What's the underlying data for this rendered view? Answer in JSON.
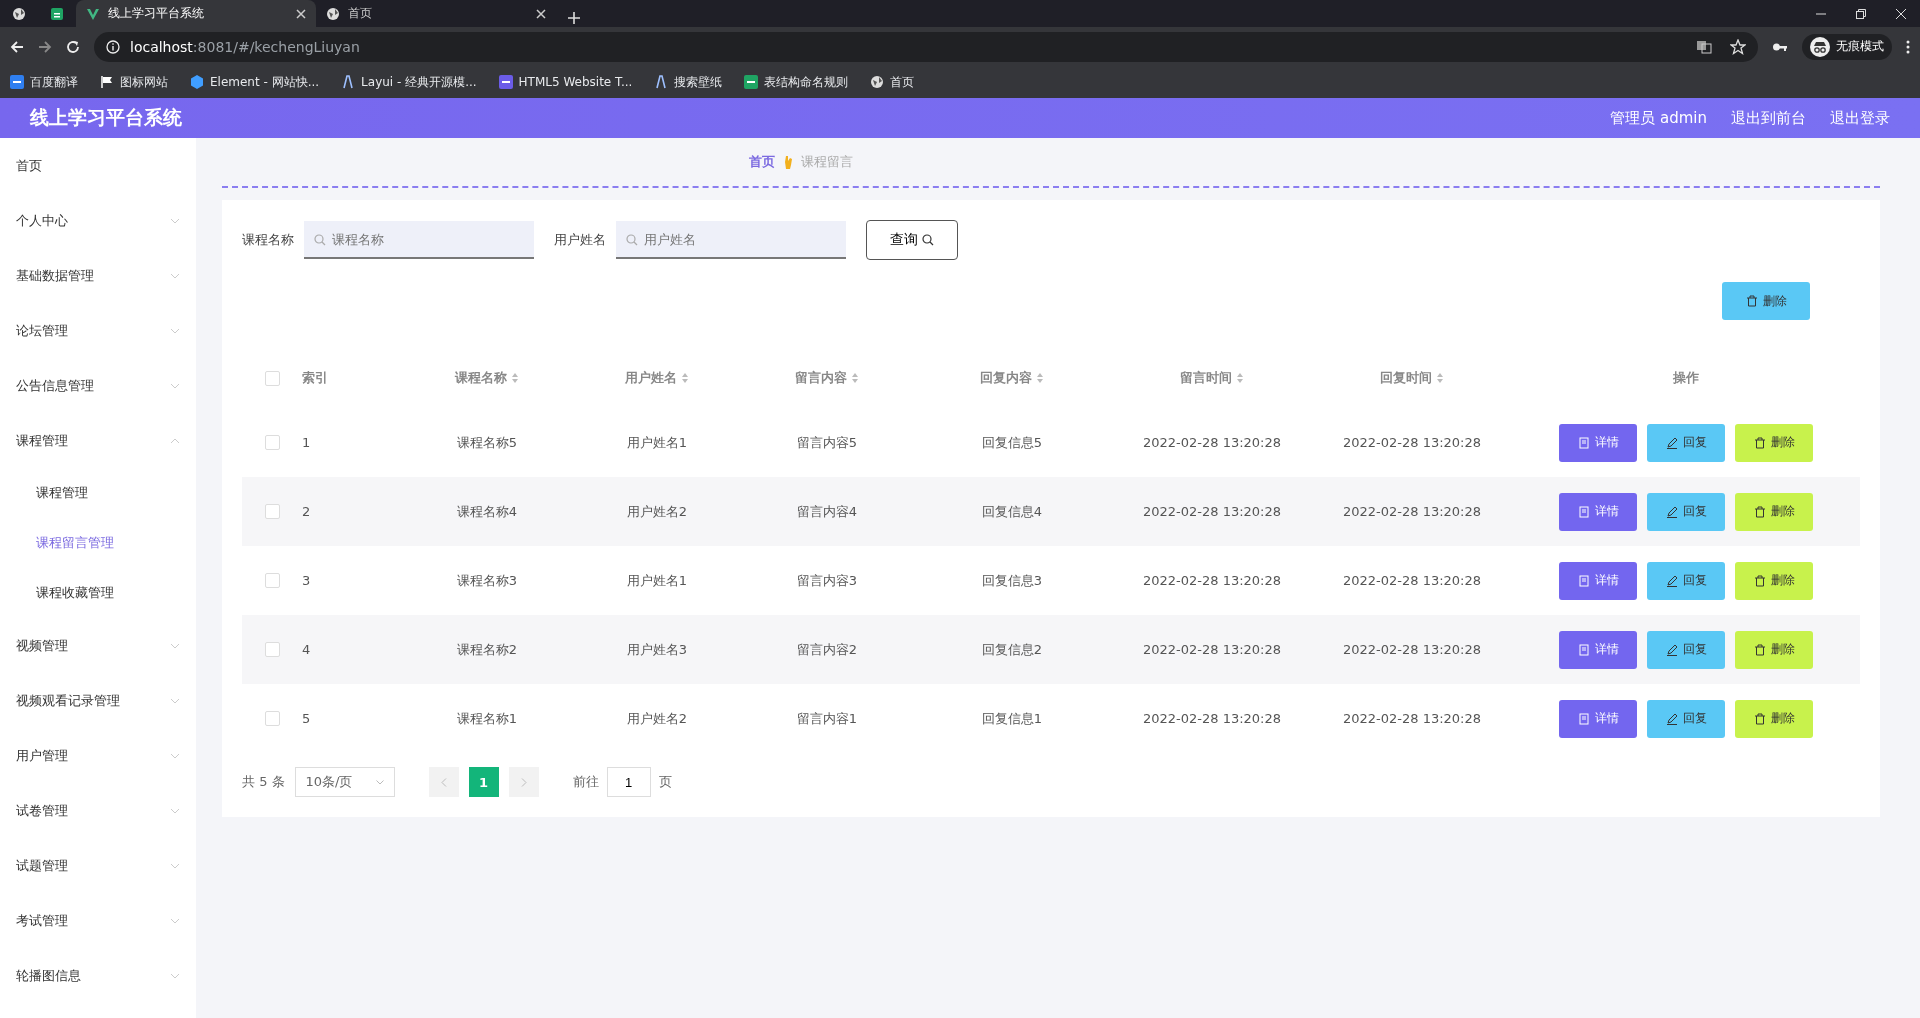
{
  "browser": {
    "tabs": [
      {
        "title": "线上学习平台系统",
        "selected": true
      },
      {
        "title": "首页",
        "selected": false
      }
    ],
    "address": {
      "host": "localhost",
      "path": ":8081/#/kechengLiuyan"
    },
    "bookmarks": [
      {
        "label": "百度翻译",
        "kind": "square",
        "color": "#2f7ff0"
      },
      {
        "label": "图标网站",
        "kind": "flag"
      },
      {
        "label": "Element - 网站快...",
        "kind": "hexagon"
      },
      {
        "label": "Layui - 经典开源模...",
        "kind": "tower"
      },
      {
        "label": "HTML5 Website T...",
        "kind": "square",
        "color": "#6b5ce7"
      },
      {
        "label": "搜索壁纸",
        "kind": "tower"
      },
      {
        "label": "表结构命名规则",
        "kind": "square",
        "color": "#1fa463"
      },
      {
        "label": "首页",
        "kind": "globe"
      }
    ],
    "profile": "无痕模式"
  },
  "app": {
    "title": "线上学习平台系统",
    "header_links": [
      "管理员 admin",
      "退出到前台",
      "退出登录"
    ]
  },
  "sidebar": {
    "items": [
      {
        "label": "首页"
      },
      {
        "label": "个人中心",
        "expanded": false
      },
      {
        "label": "基础数据管理",
        "expanded": false
      },
      {
        "label": "论坛管理",
        "expanded": false
      },
      {
        "label": "公告信息管理",
        "expanded": false
      },
      {
        "label": "课程管理",
        "expanded": true,
        "children": [
          {
            "label": "课程管理",
            "selected": false
          },
          {
            "label": "课程留言管理",
            "selected": true
          },
          {
            "label": "课程收藏管理",
            "selected": false
          }
        ]
      },
      {
        "label": "视频管理",
        "expanded": false
      },
      {
        "label": "视频观看记录管理",
        "expanded": false
      },
      {
        "label": "用户管理",
        "expanded": false
      },
      {
        "label": "试卷管理",
        "expanded": false
      },
      {
        "label": "试题管理",
        "expanded": false
      },
      {
        "label": "考试管理",
        "expanded": false
      },
      {
        "label": "轮播图信息",
        "expanded": false
      }
    ]
  },
  "breadcrumb": [
    "首页",
    "课程留言"
  ],
  "search": {
    "fields": [
      {
        "label": "课程名称",
        "placeholder": "课程名称"
      },
      {
        "label": "用户姓名",
        "placeholder": "用户姓名"
      }
    ],
    "button": "查询"
  },
  "toolbar": {
    "delete_button": "删除"
  },
  "table": {
    "all_checked": false,
    "columns": [
      {
        "label": "索引",
        "sortable": false
      },
      {
        "label": "课程名称",
        "sortable": true
      },
      {
        "label": "用户姓名",
        "sortable": true
      },
      {
        "label": "留言内容",
        "sortable": true
      },
      {
        "label": "回复内容",
        "sortable": true
      },
      {
        "label": "留言时间",
        "sortable": true
      },
      {
        "label": "回复时间",
        "sortable": true
      },
      {
        "label": "操作",
        "sortable": false
      }
    ],
    "rows": [
      {
        "checked": false,
        "cells": [
          "1",
          "课程名称5",
          "用户姓名1",
          "留言内容5",
          "回复信息5",
          "2022-02-28 13:20:28",
          "2022-02-28 13:20:28"
        ],
        "actions": [
          {
            "kind": "detail",
            "label": "详情"
          },
          {
            "kind": "reply",
            "label": "回复"
          },
          {
            "kind": "delete",
            "label": "删除"
          }
        ]
      },
      {
        "checked": false,
        "cells": [
          "2",
          "课程名称4",
          "用户姓名2",
          "留言内容4",
          "回复信息4",
          "2022-02-28 13:20:28",
          "2022-02-28 13:20:28"
        ],
        "actions": [
          {
            "kind": "detail",
            "label": "详情"
          },
          {
            "kind": "reply",
            "label": "回复"
          },
          {
            "kind": "delete",
            "label": "删除"
          }
        ]
      },
      {
        "checked": false,
        "cells": [
          "3",
          "课程名称3",
          "用户姓名1",
          "留言内容3",
          "回复信息3",
          "2022-02-28 13:20:28",
          "2022-02-28 13:20:28"
        ],
        "actions": [
          {
            "kind": "detail",
            "label": "详情"
          },
          {
            "kind": "reply",
            "label": "回复"
          },
          {
            "kind": "delete",
            "label": "删除"
          }
        ]
      },
      {
        "checked": false,
        "cells": [
          "4",
          "课程名称2",
          "用户姓名3",
          "留言内容2",
          "回复信息2",
          "2022-02-28 13:20:28",
          "2022-02-28 13:20:28"
        ],
        "actions": [
          {
            "kind": "detail",
            "label": "详情"
          },
          {
            "kind": "reply",
            "label": "回复"
          },
          {
            "kind": "delete",
            "label": "删除"
          }
        ]
      },
      {
        "checked": false,
        "cells": [
          "5",
          "课程名称1",
          "用户姓名2",
          "留言内容1",
          "回复信息1",
          "2022-02-28 13:20:28",
          "2022-02-28 13:20:28"
        ],
        "actions": [
          {
            "kind": "detail",
            "label": "详情"
          },
          {
            "kind": "reply",
            "label": "回复"
          },
          {
            "kind": "delete",
            "label": "删除"
          }
        ]
      }
    ]
  },
  "pagination": {
    "total": "共 5 条",
    "page_size": "10条/页",
    "pages": [
      {
        "label": "1",
        "selected": true
      }
    ],
    "goto_label": "前往",
    "goto_value": "1",
    "goto_suffix": "页"
  }
}
